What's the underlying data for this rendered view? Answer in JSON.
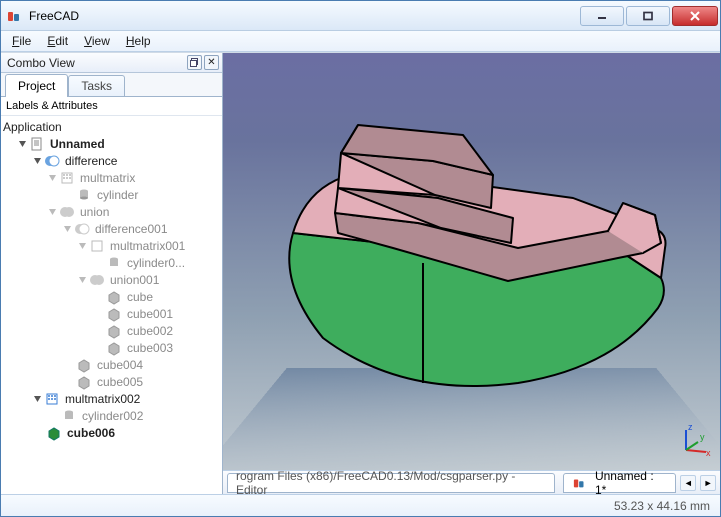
{
  "window": {
    "title": "FreeCAD"
  },
  "menu": {
    "file": "File",
    "edit": "Edit",
    "view": "View",
    "help": "Help"
  },
  "panel": {
    "title": "Combo View",
    "tabs": {
      "project": "Project",
      "tasks": "Tasks"
    },
    "subheader": "Labels & Attributes",
    "root": "Application",
    "items": {
      "unnamed": "Unnamed",
      "difference": "difference",
      "multmatrix": "multmatrix",
      "cylinder": "cylinder",
      "union": "union",
      "difference001": "difference001",
      "multmatrix001": "multmatrix001",
      "cylinder0": "cylinder0...",
      "union001": "union001",
      "cube": "cube",
      "cube001": "cube001",
      "cube002": "cube002",
      "cube003": "cube003",
      "cube004": "cube004",
      "cube005": "cube005",
      "multmatrix002": "multmatrix002",
      "cylinder002": "cylinder002",
      "cube006": "cube006"
    }
  },
  "tabstrip": {
    "editor": "rogram Files (x86)/FreeCAD0.13/Mod/csgparser.py - Editor",
    "doc": "Unnamed : 1*"
  },
  "viewport": {
    "axes": {
      "x": "x",
      "y": "y",
      "z": "z"
    }
  },
  "status": {
    "coords": "53.23 x 44.16 mm"
  }
}
